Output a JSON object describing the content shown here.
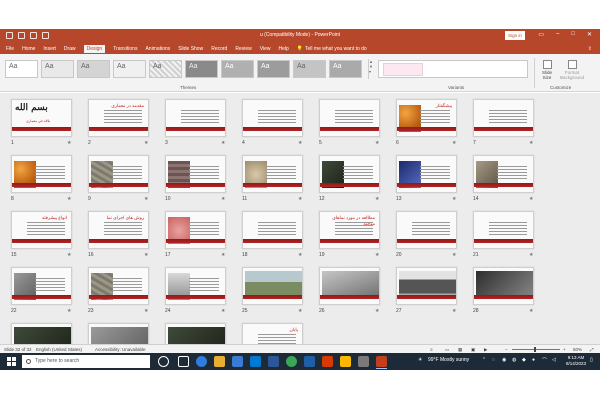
{
  "titlebar": {
    "doc_title": "u (Compatibility Mode) - PowerPoint",
    "signin_label": "Sign in"
  },
  "tabs": [
    "File",
    "Home",
    "Insert",
    "Draw",
    "Design",
    "Transitions",
    "Animations",
    "Slide Show",
    "Record",
    "Review",
    "View",
    "Help"
  ],
  "active_tab": "Design",
  "tell_me": "Tell me what you want to do",
  "ribbon": {
    "themes_label": "Themes",
    "variants_label": "Variants",
    "customize_label": "Customize",
    "slide_size_label": "Slide Size",
    "format_background_label": "Format Background",
    "theme_glyph": "Aa"
  },
  "slides": [
    {
      "n": "1",
      "type": "title",
      "heading": "بسم الله",
      "sub": "بلاقد في معماري"
    },
    {
      "n": "2",
      "type": "text",
      "heading": "مقدمه در معماری"
    },
    {
      "n": "3",
      "type": "text",
      "heading": ""
    },
    {
      "n": "4",
      "type": "text",
      "heading": ""
    },
    {
      "n": "5",
      "type": "text",
      "heading": ""
    },
    {
      "n": "6",
      "type": "pic",
      "heading": "پیشگفتار",
      "img": "orange"
    },
    {
      "n": "7",
      "type": "text",
      "heading": ""
    },
    {
      "n": "8",
      "type": "pic",
      "heading": "",
      "img": "orange"
    },
    {
      "n": "9",
      "type": "pic",
      "heading": "",
      "img": "stone"
    },
    {
      "n": "10",
      "type": "pic",
      "heading": "",
      "img": "brick"
    },
    {
      "n": "11",
      "type": "pic",
      "heading": "",
      "img": "rock"
    },
    {
      "n": "12",
      "type": "pic",
      "heading": "",
      "img": "dark"
    },
    {
      "n": "13",
      "type": "pic",
      "heading": "",
      "img": "blue"
    },
    {
      "n": "14",
      "type": "pic",
      "heading": "",
      "img": "ruin"
    },
    {
      "n": "15",
      "type": "text",
      "heading": "انواع پیشرفته"
    },
    {
      "n": "16",
      "type": "text",
      "heading": "روش های اجرای نما"
    },
    {
      "n": "17",
      "type": "pic",
      "heading": "",
      "img": "floral"
    },
    {
      "n": "18",
      "type": "text",
      "heading": ""
    },
    {
      "n": "19",
      "type": "text",
      "heading": "مطالعه در مورد نماهای موجود"
    },
    {
      "n": "20",
      "type": "text",
      "heading": ""
    },
    {
      "n": "21",
      "type": "text",
      "heading": ""
    },
    {
      "n": "22",
      "type": "pic",
      "heading": "",
      "img": "grey"
    },
    {
      "n": "23",
      "type": "pic",
      "heading": "",
      "img": "stone"
    },
    {
      "n": "24",
      "type": "pic",
      "heading": "",
      "img": "building"
    },
    {
      "n": "25",
      "type": "big",
      "heading": "",
      "img": "landscape"
    },
    {
      "n": "26",
      "type": "big",
      "heading": "",
      "img": "facade"
    },
    {
      "n": "27",
      "type": "big",
      "heading": "",
      "img": "modern"
    },
    {
      "n": "28",
      "type": "big",
      "heading": "",
      "img": "interior"
    },
    {
      "n": "29",
      "type": "big",
      "heading": "",
      "img": "dark"
    },
    {
      "n": "30",
      "type": "big",
      "heading": "",
      "img": "grey"
    },
    {
      "n": "31",
      "type": "big",
      "heading": "",
      "img": "dark"
    },
    {
      "n": "32",
      "type": "text",
      "heading": "پایان"
    }
  ],
  "status": {
    "slide_of": "Slide 32 of 32",
    "language": "English (United States)",
    "accessibility": "Accessibility: Unavailable",
    "zoom": "50%"
  },
  "taskbar": {
    "search_placeholder": "Type here to search",
    "weather": "99°F  Mostly sunny",
    "time": "9:13 AM",
    "date": "8/14/2023"
  },
  "colors": {
    "accent": "#b7472a",
    "slide_bar": "#b32424"
  }
}
